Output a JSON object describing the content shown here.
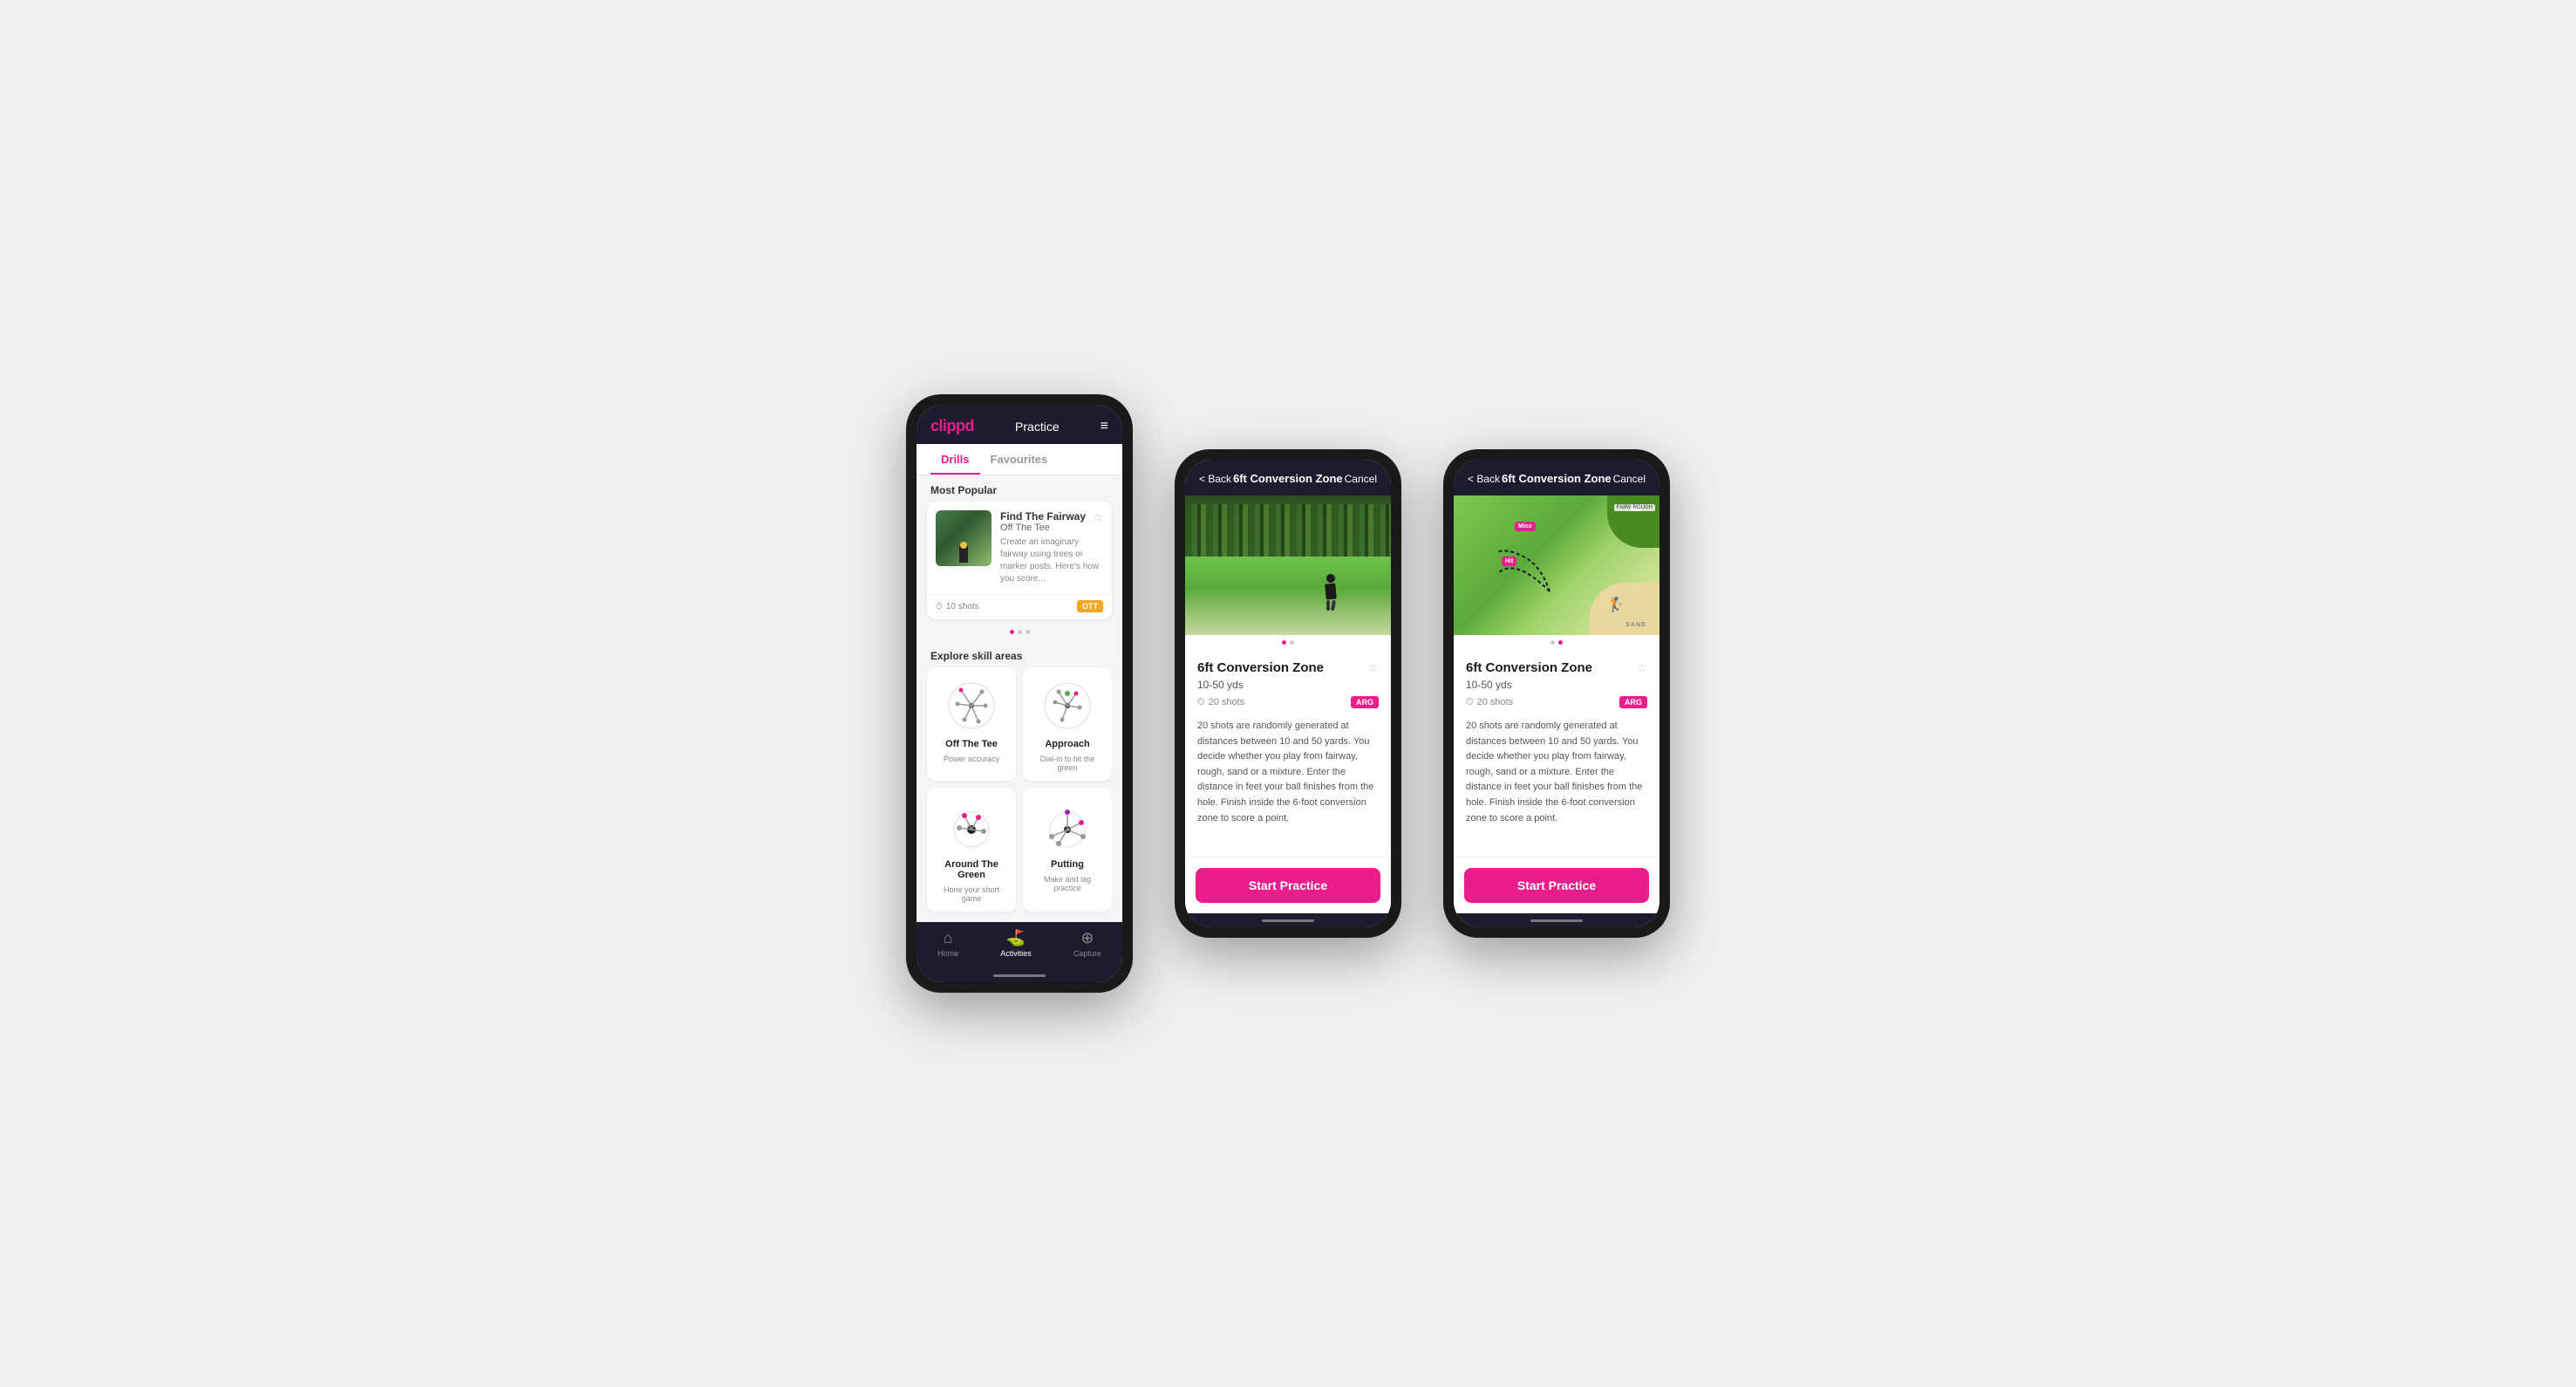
{
  "app": {
    "logo": "clippd",
    "nav_title": "Practice",
    "menu_icon": "≡"
  },
  "phone1": {
    "tabs": [
      "Drills",
      "Favourites"
    ],
    "active_tab": "Drills",
    "section_most_popular": "Most Popular",
    "featured_drill": {
      "title": "Find The Fairway",
      "subtitle": "Off The Tee",
      "description": "Create an imaginary fairway using trees or marker posts. Here's how you score...",
      "shots": "10 shots",
      "tag": "OTT"
    },
    "section_explore": "Explore skill areas",
    "skills": [
      {
        "name": "Off The Tee",
        "desc": "Power accuracy",
        "icon": "ott"
      },
      {
        "name": "Approach",
        "desc": "Dial-in to hit the green",
        "icon": "approach"
      },
      {
        "name": "Around The Green",
        "desc": "Hone your short game",
        "icon": "atg"
      },
      {
        "name": "Putting",
        "desc": "Make and lag practice",
        "icon": "putting"
      }
    ],
    "bottom_nav": [
      {
        "label": "Home",
        "icon": "⌂",
        "active": false
      },
      {
        "label": "Activities",
        "icon": "⛳",
        "active": true
      },
      {
        "label": "Capture",
        "icon": "⊕",
        "active": false
      }
    ]
  },
  "phone2": {
    "back_label": "< Back",
    "header_title": "6ft Conversion Zone",
    "cancel_label": "Cancel",
    "drill_name": "6ft Conversion Zone",
    "drill_range": "10-50 yds",
    "shots": "20 shots",
    "tag": "ARG",
    "description": "20 shots are randomly generated at distances between 10 and 50 yards. You decide whether you play from fairway, rough, sand or a mixture. Enter the distance in feet your ball finishes from the hole. Finish inside the 6-foot conversion zone to score a point.",
    "start_button": "Start Practice"
  },
  "phone3": {
    "back_label": "< Back",
    "header_title": "6ft Conversion Zone",
    "cancel_label": "Cancel",
    "drill_name": "6ft Conversion Zone",
    "drill_range": "10-50 yds",
    "shots": "20 shots",
    "tag": "ARG",
    "description": "20 shots are randomly generated at distances between 10 and 50 yards. You decide whether you play from fairway, rough, sand or a mixture. Enter the distance in feet your ball finishes from the hole. Finish inside the 6-foot conversion zone to score a point.",
    "start_button": "Start Practice",
    "map_labels": {
      "fairway": "FAIRWAY",
      "rough": "ROUGH",
      "sand": "SAND",
      "hit": "Hit",
      "miss": "Miss"
    }
  },
  "colors": {
    "brand_pink": "#e91e8c",
    "brand_dark": "#1c1c2e",
    "tag_ott": "#f5a623",
    "tag_arg": "#e91e8c"
  }
}
